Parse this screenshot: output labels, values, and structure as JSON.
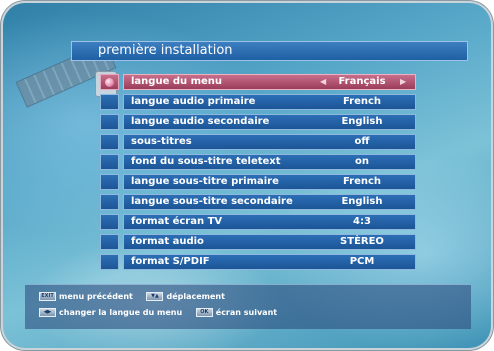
{
  "title": "première installation",
  "menu": [
    {
      "label": "langue du menu",
      "value": "Français",
      "active": true
    },
    {
      "label": "langue audio primaire",
      "value": "French"
    },
    {
      "label": "langue audio secondaire",
      "value": "English"
    },
    {
      "label": "sous-titres",
      "value": "off"
    },
    {
      "label": "fond du sous-titre teletext",
      "value": "on"
    },
    {
      "label": "langue sous-titre primaire",
      "value": "French"
    },
    {
      "label": "langue sous-titre secondaire",
      "value": "English"
    },
    {
      "label": "format écran TV",
      "value": "4:3"
    },
    {
      "label": "format audio",
      "value": "STÈREO"
    },
    {
      "label": "format S/PDIF",
      "value": "PCM"
    }
  ],
  "help": {
    "exit_key": "EXIT",
    "exit_label": "menu précédent",
    "nav_key": "▼▲",
    "nav_label": "déplacement",
    "lr_key": "◀▶",
    "lr_label": "changer la langue du menu",
    "ok_key": "OK",
    "ok_label": "écran suivant"
  },
  "colors": {
    "accent": "#1d5596",
    "selected": "#b04f6e"
  }
}
